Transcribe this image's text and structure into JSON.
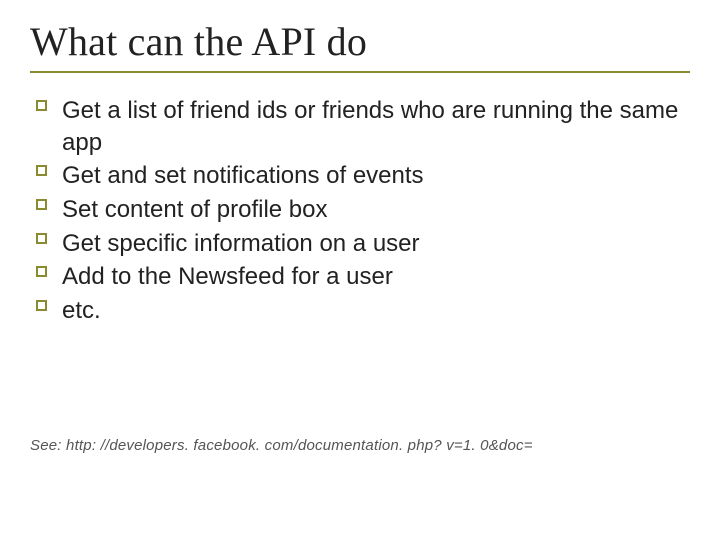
{
  "title": "What can the API do",
  "bullets": [
    "Get a list of friend ids or friends who are running the same app",
    "Get and set notifications of events",
    "Set content of profile box",
    "Get specific information on a user",
    "Add to the Newsfeed for a user",
    "etc."
  ],
  "footnote": "See: http: //developers. facebook. com/documentation. php? v=1. 0&doc="
}
